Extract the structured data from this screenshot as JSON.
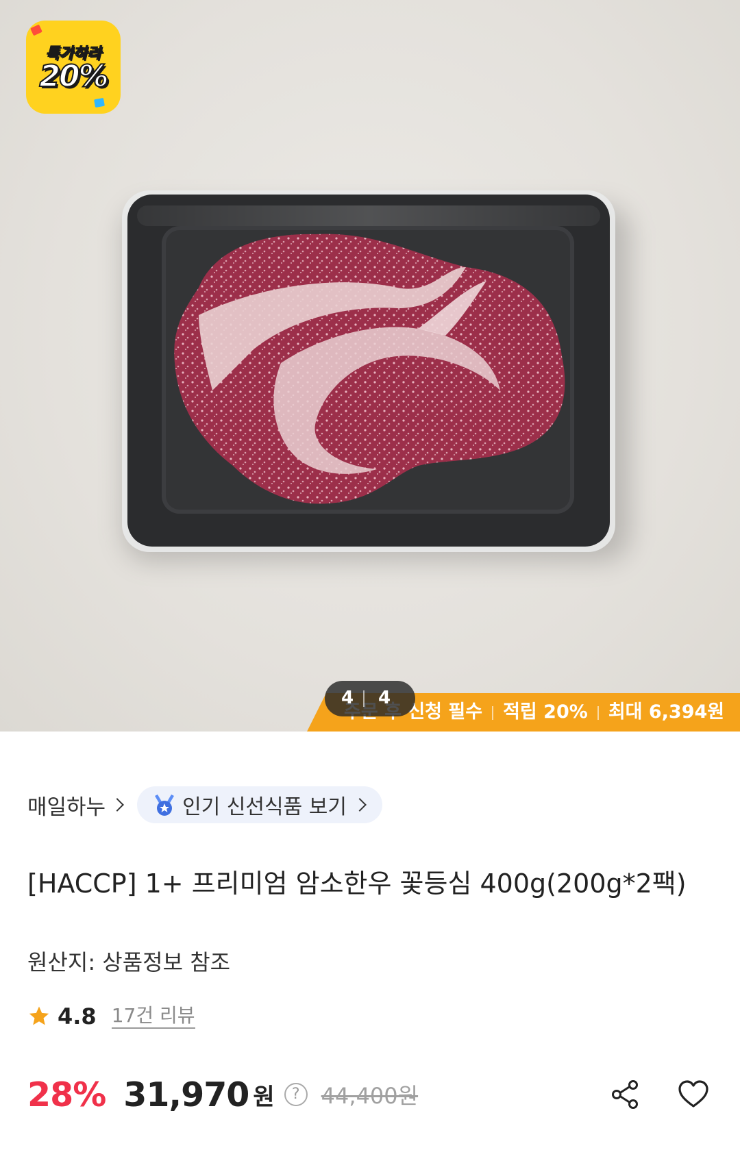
{
  "badge": {
    "top": "특가하라",
    "percent": "20%"
  },
  "gallery": {
    "current": "4",
    "total": "4"
  },
  "promo": {
    "text1": "주문 후 신청 필수",
    "text2": "적립 20%",
    "text3": "최대 6,394원"
  },
  "brand": {
    "name": "매일하누",
    "popular_label": "인기 신선식품 보기"
  },
  "product": {
    "title": "[HACCP] 1+ 프리미엄 암소한우 꽃등심 400g(200g*2팩)",
    "origin": "원산지: 상품정보 참조"
  },
  "rating": {
    "score": "4.8",
    "reviews": "17건 리뷰"
  },
  "price": {
    "discount": "28%",
    "sale": "31,970",
    "currency": "원",
    "help": "?",
    "original": "44,400원"
  },
  "colors": {
    "discount": "#f0314a",
    "promo": "#f5a31b",
    "badge": "#ffd21f",
    "star": "#f5a31b"
  },
  "icons": [
    "medal-icon",
    "star-icon",
    "help-icon",
    "share-icon",
    "heart-icon"
  ]
}
